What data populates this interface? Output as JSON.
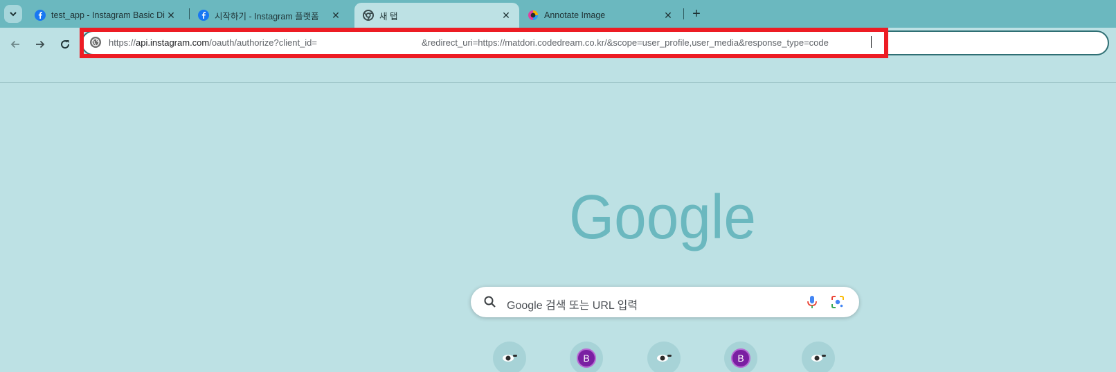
{
  "tabs": [
    {
      "title": "test_app - Instagram Basic Dis",
      "favicon": "facebook-icon",
      "active": false
    },
    {
      "title": "시작하기 - Instagram 플랫폼",
      "favicon": "facebook-icon",
      "active": false
    },
    {
      "title": "새 탭",
      "favicon": "chrome-icon",
      "active": true
    },
    {
      "title": "Annotate Image",
      "favicon": "annotate-icon",
      "active": false
    }
  ],
  "address_bar": {
    "url_prefix": "https://",
    "url_host": "api.instagram.com",
    "url_path_start": "/oauth/authorize?client_id=",
    "url_rest": "&redirect_uri=https://matdori.codedream.co.kr/&scope=user_profile,user_media&response_type=code"
  },
  "search": {
    "placeholder": "Google 검색 또는 URL 입력"
  },
  "logo_text": "Google",
  "shortcuts": [
    {
      "kind": "eye-icon"
    },
    {
      "kind": "letter",
      "letter": "B"
    },
    {
      "kind": "eye-icon"
    },
    {
      "kind": "letter",
      "letter": "B"
    },
    {
      "kind": "eye-icon"
    }
  ],
  "colors": {
    "tabstrip": "#6bb8bf",
    "background": "#bde1e4",
    "highlight": "#ed1c24",
    "logo": "#6bb8bf"
  }
}
